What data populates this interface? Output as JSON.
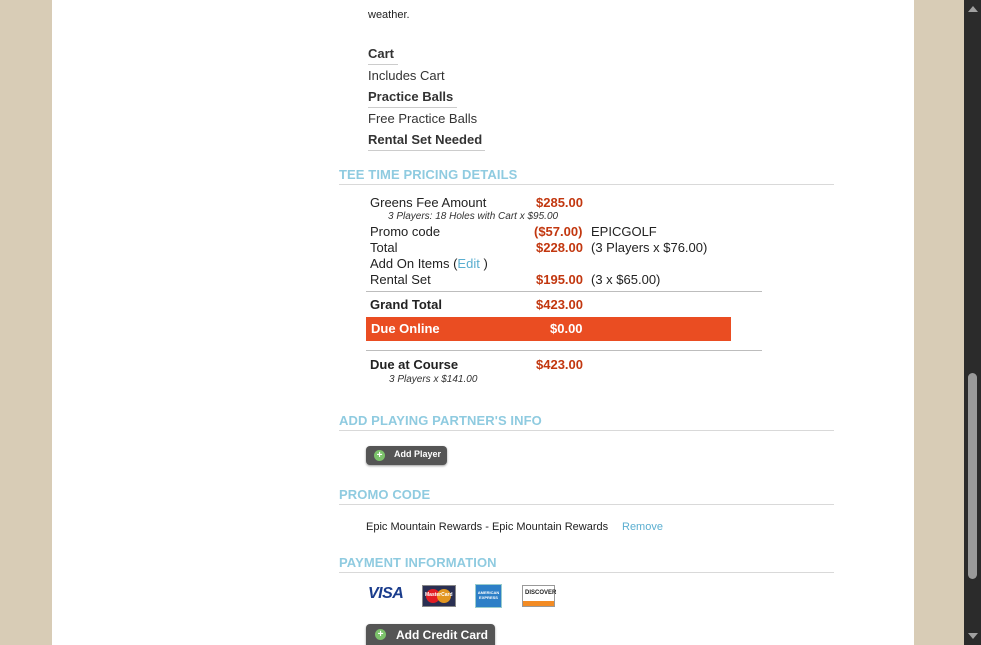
{
  "intro_text": "weather.",
  "options": [
    {
      "heading": "Cart",
      "value": "Includes Cart"
    },
    {
      "heading": "Practice Balls",
      "value": "Free Practice Balls"
    },
    {
      "heading": "Rental Set Needed",
      "value": ""
    }
  ],
  "sections": {
    "pricing": "TEE TIME PRICING DETAILS",
    "partners": "ADD PLAYING PARTNER'S INFO",
    "promo": "PROMO CODE",
    "payment": "PAYMENT INFORMATION"
  },
  "pricing": {
    "greens_fee_label": "Greens Fee Amount",
    "greens_fee_amount": "$285.00",
    "greens_fee_detail": "3 Players: 18 Holes with Cart x $95.00",
    "promo_label": "Promo code",
    "promo_amount": "($57.00)",
    "promo_code": "EPICGOLF",
    "total_label": "Total",
    "total_amount": "$228.00",
    "total_detail": "(3 Players x $76.00)",
    "addon_label": "Add On Items (",
    "addon_edit": "Edit",
    "addon_close": " )",
    "rental_label": "Rental Set",
    "rental_amount": "$195.00",
    "rental_detail": "(3 x $65.00)",
    "grand_total_label": "Grand Total",
    "grand_total_amount": "$423.00",
    "due_online_label": "Due Online",
    "due_online_amount": "$0.00",
    "due_course_label": "Due at Course",
    "due_course_amount": "$423.00",
    "due_course_detail": "3 Players x $141.00"
  },
  "buttons": {
    "add_player": "Add Player",
    "add_credit_card": "Add Credit Card"
  },
  "promo": {
    "text": "Epic Mountain Rewards - Epic Mountain Rewards",
    "remove": "Remove"
  },
  "cards": {
    "visa": "VISA",
    "mastercard": "MasterCard",
    "amex": "AMERICAN EXPRESS",
    "discover": "DISCOVER"
  },
  "colors": {
    "accent_orange": "#ea4d22",
    "price_red": "#c2370f",
    "section_blue": "#8fcbe0",
    "link_blue": "#5aaed0",
    "background_tan": "#d8ccb6"
  }
}
